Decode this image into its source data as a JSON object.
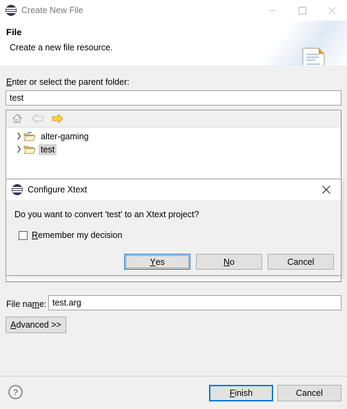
{
  "window": {
    "title": "Create New File",
    "app_icon": "eclipse-icon",
    "controls": {
      "minimize": "minimize-icon",
      "maximize": "maximize-icon",
      "close": "close-icon"
    }
  },
  "header": {
    "title": "File",
    "subtitle": "Create a new file resource.",
    "banner_icon": "new-file-icon"
  },
  "parent_folder": {
    "label_prefix": "E",
    "label_rest": "nter or select the parent folder:",
    "value": "test"
  },
  "tree": {
    "toolbar": [
      {
        "name": "home-icon",
        "state": "disabled"
      },
      {
        "name": "back-arrow-icon",
        "state": "disabled"
      },
      {
        "name": "forward-arrow-icon",
        "state": "enabled"
      }
    ],
    "rows": [
      {
        "label": "alter-gaming",
        "selected": false,
        "expanded": false,
        "icon": "project-folder-icon"
      },
      {
        "label": "test",
        "selected": true,
        "expanded": false,
        "icon": "folder-icon"
      }
    ]
  },
  "file_name": {
    "label_a": "File na",
    "label_u": "m",
    "label_b": "e:",
    "value": "test.arg"
  },
  "advanced_button": {
    "accel": "A",
    "rest": "dvanced >>"
  },
  "footer": {
    "help_icon": "help-question-icon",
    "finish": {
      "accel": "F",
      "rest": "inish"
    },
    "cancel": "Cancel"
  },
  "modal": {
    "title": "Configure Xtext",
    "app_icon": "eclipse-icon",
    "close_icon": "close-icon",
    "message": "Do you want to convert 'test' to an Xtext project?",
    "checkbox": {
      "checked": false,
      "accel": "R",
      "rest": "emember my decision"
    },
    "buttons": [
      {
        "accel": "Y",
        "rest": "es",
        "default": true
      },
      {
        "accel": "N",
        "rest": "o",
        "default": false
      },
      {
        "accel": "",
        "rest": "Cancel",
        "default": false
      }
    ]
  },
  "colors": {
    "accent": "#0078d7",
    "titlebar_text": "#7a7a7a",
    "selection": "#d4d4d4",
    "button_face": "#e1e1e1",
    "dialog_face": "#f0f0f0"
  }
}
